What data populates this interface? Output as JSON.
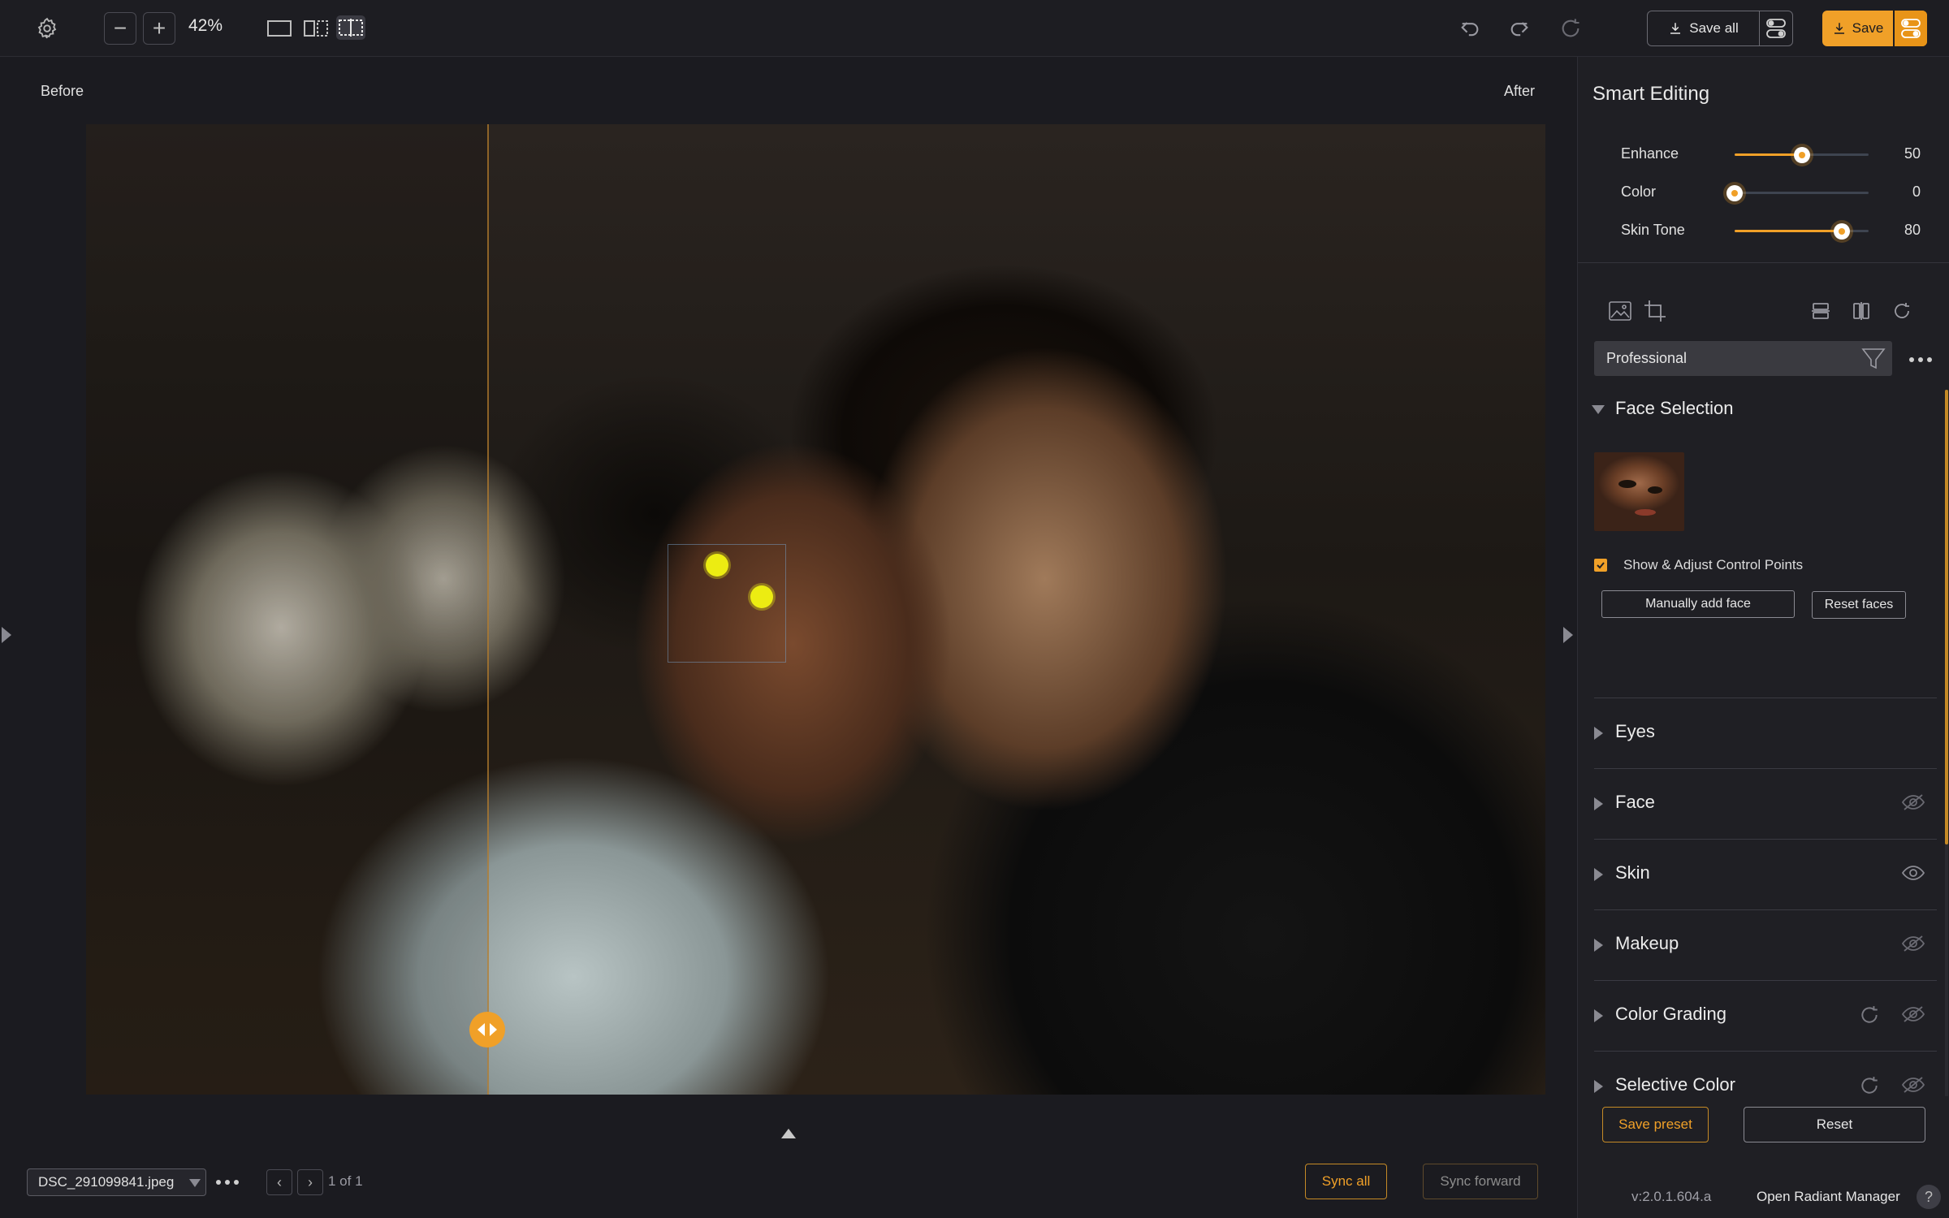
{
  "toolbar": {
    "zoom": "42%",
    "save_all_label": "Save all",
    "save_label": "Save"
  },
  "canvas": {
    "before_label": "Before",
    "after_label": "After",
    "divider_position_fraction": 0.275
  },
  "bottom": {
    "file_name": "DSC_291099841.jpeg",
    "page_count": "1 of 1",
    "sync_all_label": "Sync all",
    "sync_forward_label": "Sync forward"
  },
  "panel": {
    "title": "Smart Editing",
    "sliders": [
      {
        "name": "Enhance",
        "value": 50,
        "max": 100
      },
      {
        "name": "Color",
        "value": 0,
        "max": 100
      },
      {
        "name": "Skin Tone",
        "value": 80,
        "max": 100
      }
    ],
    "preset": "Professional",
    "face_selection": {
      "title": "Face Selection",
      "checkbox_label": "Show & Adjust Control Points",
      "checked": true,
      "manual_add_label": "Manually add face",
      "reset_faces_label": "Reset faces"
    },
    "sections": [
      {
        "name": "Eyes"
      },
      {
        "name": "Face"
      },
      {
        "name": "Skin"
      },
      {
        "name": "Makeup"
      },
      {
        "name": "Color Grading"
      },
      {
        "name": "Selective Color"
      }
    ],
    "save_preset_label": "Save preset",
    "reset_label": "Reset",
    "version": "v:2.0.1.604.a",
    "open_manager_label": "Open Radiant Manager",
    "help_label": "?"
  },
  "colors": {
    "accent": "#f0a028",
    "background": "#1b1b20",
    "panel": "#1f1f24"
  },
  "icons": [
    "settings-icon",
    "zoom-out-icon",
    "zoom-in-icon",
    "single-view-icon",
    "split-view-icon",
    "compare-view-icon",
    "undo-icon",
    "redo-icon",
    "refresh-icon",
    "download-icon",
    "toggle-icon",
    "image-icon",
    "crop-icon",
    "flip-vertical-icon",
    "flip-horizontal-icon",
    "rotate-icon",
    "filter-icon",
    "eye-icon",
    "reset-icon"
  ]
}
